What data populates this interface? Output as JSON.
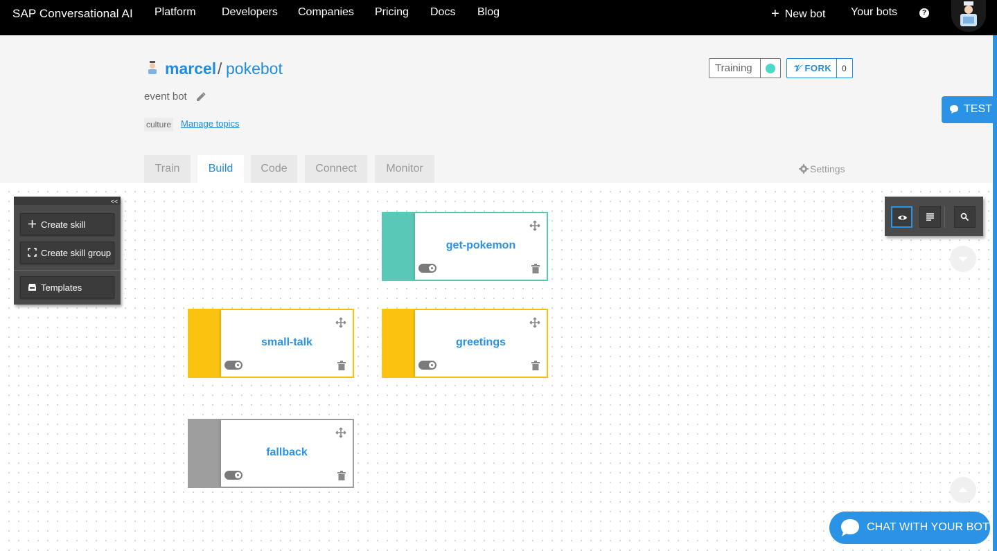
{
  "nav": {
    "brand": "SAP Conversational AI",
    "links": [
      "Platform",
      "Developers",
      "Companies",
      "Pricing",
      "Docs",
      "Blog"
    ],
    "new_bot": "New bot",
    "your_bots": "Your bots",
    "help": "?"
  },
  "bot": {
    "owner": "marcel",
    "separator": "/",
    "name": "pokebot",
    "description": "event bot",
    "topic": "culture",
    "manage_topics": "Manage topics"
  },
  "status": {
    "training_label": "Training",
    "training_color": "#4ed8c9",
    "fork_label": "FORK",
    "fork_count": "0"
  },
  "test_button": "TEST",
  "tabs": [
    {
      "label": "Train",
      "active": false
    },
    {
      "label": "Build",
      "active": true
    },
    {
      "label": "Code",
      "active": false
    },
    {
      "label": "Connect",
      "active": false
    },
    {
      "label": "Monitor",
      "active": false
    }
  ],
  "settings_label": "Settings",
  "toolbox": {
    "collapse": "<<",
    "create_skill": "Create skill",
    "create_skill_group": "Create skill group",
    "templates": "Templates"
  },
  "view_tools": [
    "eye-icon",
    "list-icon",
    "search-icon"
  ],
  "skills": [
    {
      "name": "get-pokemon",
      "color": "#5ac8b6"
    },
    {
      "name": "small-talk",
      "color": "#fbc30f"
    },
    {
      "name": "greetings",
      "color": "#fbc30f"
    },
    {
      "name": "fallback",
      "color": "#9e9e9e"
    }
  ],
  "chat_button": "CHAT WITH YOUR BOT",
  "colors": {
    "accent": "#2b93e6",
    "nav_bg": "#000000"
  }
}
